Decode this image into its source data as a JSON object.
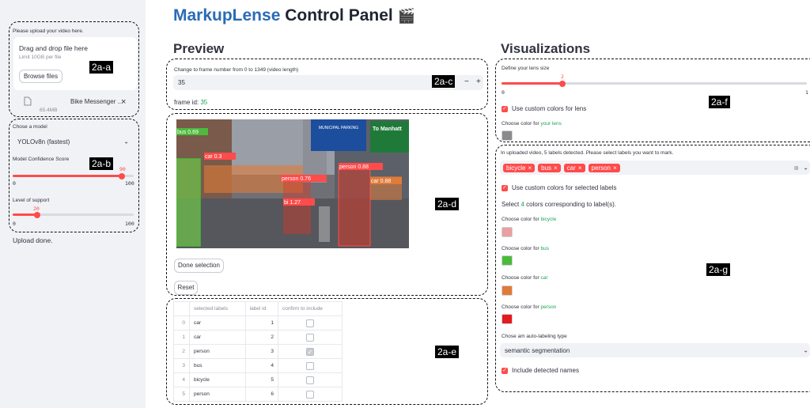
{
  "app": {
    "title_brand": "MarkupLense",
    "title_rest": " Control Panel",
    "title_emoji": "🎬"
  },
  "sidebar": {
    "upload_label": "Please upload your video here.",
    "drop_title": "Drag and drop file here",
    "drop_limit": "Limit 10GB per file",
    "browse_label": "Browse files",
    "file_name": "Bike Messenger ...",
    "file_size": "65.4MB",
    "close_glyph": "×",
    "model_label": "Chose a model",
    "model_value": "YOLOv8n (fastest)",
    "confidence_label": "Model Confidence Score",
    "confidence_value": "90",
    "confidence_fraction": 0.9,
    "confidence_min": "0",
    "confidence_max": "100",
    "support_label": "Level of support",
    "support_value": "20",
    "support_fraction": 0.2,
    "support_min": "0",
    "support_max": "100",
    "status": "Upload done."
  },
  "preview": {
    "heading": "Preview",
    "frame_label": "Change to frame number from 0 to 1349 (video length)",
    "frame_input": "35",
    "minus": "−",
    "plus": "+",
    "frame_id_label": "frame id:",
    "frame_id_value": "35",
    "done_label": "Done selection",
    "reset_label": "Reset",
    "table": {
      "headers": [
        "selected labels",
        "label id",
        "confirm to include"
      ],
      "rows": [
        {
          "index": "0",
          "label": "car",
          "id": "1",
          "checked": false
        },
        {
          "index": "1",
          "label": "car",
          "id": "2",
          "checked": false
        },
        {
          "index": "2",
          "label": "person",
          "id": "3",
          "checked": true
        },
        {
          "index": "3",
          "label": "bus",
          "id": "4",
          "checked": false
        },
        {
          "index": "4",
          "label": "bicycle",
          "id": "5",
          "checked": false
        },
        {
          "index": "5",
          "label": "person",
          "id": "6",
          "checked": false
        }
      ]
    },
    "frame_overlay": {
      "sign_municipal": "MUNICIPAL PARKING",
      "sign_manhattan": "To Manhatt",
      "detections": [
        "bus 0.69",
        "car 0.3",
        "person 0.88",
        "person 0.76",
        "car 0.88",
        "bi 1.27"
      ]
    }
  },
  "visualizations": {
    "heading": "Visualizations",
    "lens_label": "Define your lens size",
    "lens_value": "2",
    "lens_fraction": 0.2,
    "lens_min": "0",
    "lens_max": "1",
    "lens_custom_label": "Use custom colors for lens",
    "lens_color_prefix": "Choose color for ",
    "lens_color_target": "your lens",
    "lens_color": "#8a8a8a",
    "detected_label": "In uploaded video, 5 labels detected. Please select labels you want to mark.",
    "chips": [
      "bicycle",
      "bus",
      "car",
      "person"
    ],
    "chip_x": "×",
    "labels_custom_label": "Use custom colors for selected labels",
    "select_prefix": "Select ",
    "select_count": "4",
    "select_suffix": " colors corresponding to label(s).",
    "color_prefix": "Choose color for ",
    "label_colors": [
      {
        "name": "bicycle",
        "color": "#e8a0a0"
      },
      {
        "name": "bus",
        "color": "#4cbb3c"
      },
      {
        "name": "car",
        "color": "#e07b39"
      },
      {
        "name": "person",
        "color": "#e41a1c"
      }
    ],
    "autolabel_label": "Chose am auto-labeling type",
    "autolabel_value": "semantic segmentation",
    "names_label": "Include detected names"
  },
  "callouts": {
    "a": "2a-a",
    "b": "2a-b",
    "c": "2a-c",
    "d": "2a-d",
    "e": "2a-e",
    "f": "2a-f",
    "g": "2a-g"
  }
}
